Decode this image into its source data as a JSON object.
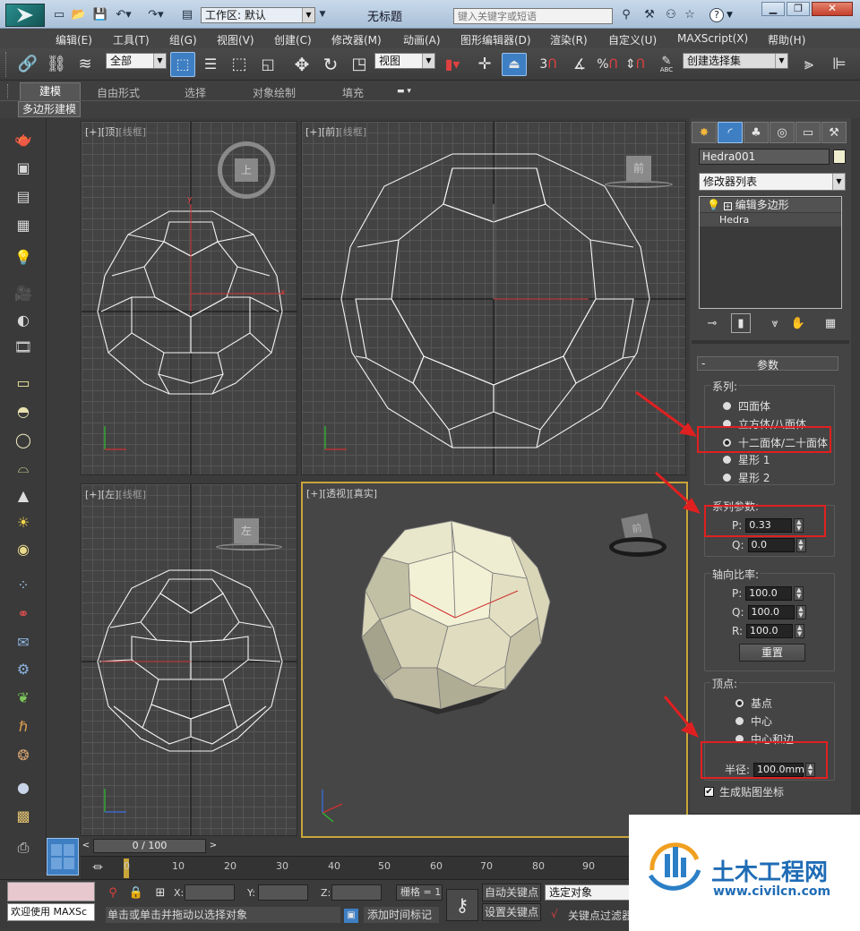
{
  "window": {
    "title": "无标题",
    "workspace_label": "工作区: 默认",
    "search_placeholder": "键入关键字或短语",
    "help_label": "?"
  },
  "menu": [
    "编辑(E)",
    "工具(T)",
    "组(G)",
    "视图(V)",
    "创建(C)",
    "修改器(M)",
    "动画(A)",
    "图形编辑器(D)",
    "渲染(R)",
    "自定义(U)",
    "MAXScript(X)",
    "帮助(H)"
  ],
  "toolbar": {
    "filter_value": "全部",
    "refcoord_value": "视图",
    "named_sel_value": "创建选择集",
    "snap3": "3",
    "snap_pct": "%",
    "abc": "ABC"
  },
  "ribbon": {
    "tabs": [
      "建模",
      "自由形式",
      "选择",
      "对象绘制",
      "填充"
    ],
    "subtab": "多边形建模"
  },
  "viewports": {
    "top": {
      "l1": "[+]",
      "l2": "[顶]",
      "l3": "[线框]",
      "cube": "上"
    },
    "front": {
      "l1": "[+]",
      "l2": "[前]",
      "l3": "[线框]",
      "cube": "前"
    },
    "left": {
      "l1": "[+]",
      "l2": "[左]",
      "l3": "[线框]",
      "cube": "左"
    },
    "persp": {
      "l1": "[+]",
      "l2": "[透视]",
      "l3": "[真实]",
      "cube": "前"
    }
  },
  "axes": {
    "x": "x",
    "y": "y",
    "z": "z"
  },
  "panel": {
    "object_name": "Hedra001",
    "modifier_list": "修改器列表",
    "stack": [
      "编辑多边形",
      "Hedra"
    ],
    "rollout": "参数",
    "rollout_toggle": "-",
    "family": {
      "title": "系列:",
      "options": [
        "四面体",
        "立方体/八面体",
        "十二面体/二十面体",
        "星形 1",
        "星形 2"
      ],
      "selected": 2
    },
    "family_params": {
      "title": "系列参数:",
      "P_label": "P:",
      "P": "0.33",
      "Q_label": "Q:",
      "Q": "0.0"
    },
    "axis_scale": {
      "title": "轴向比率:",
      "P_label": "P:",
      "P": "100.0",
      "Q_label": "Q:",
      "Q": "100.0",
      "R_label": "R:",
      "R": "100.0",
      "reset": "重置"
    },
    "vertices": {
      "title": "顶点:",
      "options": [
        "基点",
        "中心",
        "中心和边"
      ],
      "selected": 0
    },
    "radius_label": "半径:",
    "radius": "100.0mm",
    "gen_map": "生成贴图坐标"
  },
  "timeline": {
    "frame": "0 / 100",
    "ticks": [
      "0",
      "10",
      "20",
      "30",
      "40",
      "50",
      "60",
      "70",
      "80",
      "90"
    ]
  },
  "status": {
    "welcome": "欢迎使用 MAXSc",
    "prompt": "单击或单击并拖动以选择对象",
    "add_tag": "添加时间标记",
    "x_label": "X:",
    "y_label": "Y:",
    "z_label": "Z:",
    "grid": "栅格 = 1",
    "auto_key": "自动关键点",
    "set_key": "设置关键点",
    "sel_obj": "选定对象",
    "key_filter": "关键点过滤器"
  },
  "watermark": {
    "brand": "土木工程网",
    "url": "www.civilcn.com"
  },
  "colors": {
    "accent": "#e02020",
    "selected": "#3e7fc4"
  }
}
